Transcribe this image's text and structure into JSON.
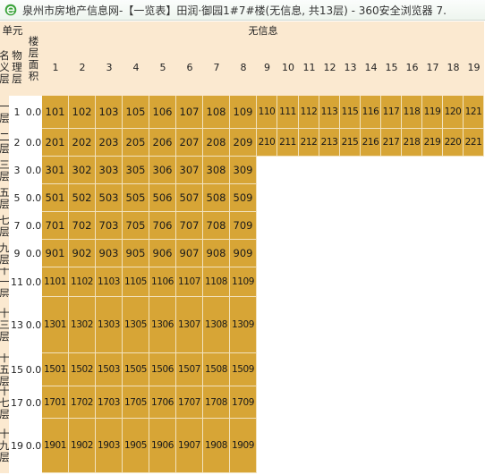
{
  "window": {
    "title": "泉州市房地产信息网-【一览表】田润·御园1#7#楼(无信息, 共13层) - 360安全浏览器 7."
  },
  "table": {
    "header": {
      "unit_label": "单元",
      "nominal_floor_label": "名义层",
      "physical_floor_label": "物理层",
      "floor_area_label": "楼层面积",
      "group_label": "无信息",
      "columns": [
        "1",
        "2",
        "3",
        "4",
        "5",
        "6",
        "7",
        "8",
        "9",
        "10",
        "11",
        "12",
        "13",
        "14",
        "15",
        "16",
        "17",
        "18",
        "19"
      ]
    },
    "rows": [
      {
        "nominal": "一层",
        "physical": "1",
        "area": "0.0",
        "units": [
          "101",
          "102",
          "103",
          "105",
          "106",
          "107",
          "108",
          "109",
          "110",
          "111",
          "112",
          "113",
          "115",
          "116",
          "117",
          "118",
          "119",
          "120",
          "121"
        ]
      },
      {
        "nominal": "二层",
        "physical": "2",
        "area": "0.0",
        "units": [
          "201",
          "202",
          "203",
          "205",
          "206",
          "207",
          "208",
          "209",
          "210",
          "211",
          "212",
          "213",
          "215",
          "216",
          "217",
          "218",
          "219",
          "220",
          "221"
        ]
      },
      {
        "nominal": "三层",
        "physical": "3",
        "area": "0.0",
        "units": [
          "301",
          "302",
          "303",
          "305",
          "306",
          "307",
          "308",
          "309"
        ]
      },
      {
        "nominal": "五层",
        "physical": "5",
        "area": "0.0",
        "units": [
          "501",
          "502",
          "503",
          "505",
          "506",
          "507",
          "508",
          "509"
        ]
      },
      {
        "nominal": "七层",
        "physical": "7",
        "area": "0.0",
        "units": [
          "701",
          "702",
          "703",
          "705",
          "706",
          "707",
          "708",
          "709"
        ]
      },
      {
        "nominal": "九层",
        "physical": "9",
        "area": "0.0",
        "units": [
          "901",
          "902",
          "903",
          "905",
          "906",
          "907",
          "908",
          "909"
        ]
      },
      {
        "nominal": "十一层",
        "physical": "11",
        "area": "0.0",
        "units": [
          "1101",
          "1102",
          "1103",
          "1105",
          "1106",
          "1107",
          "1108",
          "1109"
        ]
      },
      {
        "nominal": "十三层",
        "physical": "13",
        "area": "0.0",
        "units": [
          "1301",
          "1302",
          "1303",
          "1305",
          "1306",
          "1307",
          "1308",
          "1309"
        ]
      },
      {
        "nominal": "十五层",
        "physical": "15",
        "area": "0.0",
        "units": [
          "1501",
          "1502",
          "1503",
          "1505",
          "1506",
          "1507",
          "1508",
          "1509"
        ]
      },
      {
        "nominal": "十七层",
        "physical": "17",
        "area": "0.0",
        "units": [
          "1701",
          "1702",
          "1703",
          "1705",
          "1706",
          "1707",
          "1708",
          "1709"
        ]
      },
      {
        "nominal": "十九层",
        "physical": "19",
        "area": "0.0",
        "units": [
          "1901",
          "1902",
          "1903",
          "1905",
          "1906",
          "1907",
          "1908",
          "1909"
        ]
      }
    ]
  },
  "colors": {
    "unit_cell": "#d7a536",
    "header_bg": "#fbe9d0"
  },
  "icons": {
    "app": "browser-e-icon"
  }
}
